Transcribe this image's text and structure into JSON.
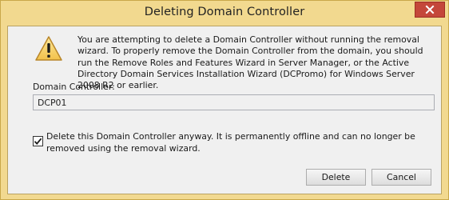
{
  "window": {
    "title": "Deleting Domain Controller"
  },
  "warning": {
    "icon": "warning-icon",
    "message": "You are attempting to delete a Domain Controller without running the removal wizard. To properly remove the Domain Controller from the domain, you should run the Remove Roles and Features Wizard in Server Manager, or the Active Directory Domain Services Installation Wizard (DCPromo) for Windows Server 2008 R2 or earlier."
  },
  "domain_controller": {
    "label": "Domain Controller:",
    "value": "DCP01"
  },
  "confirm": {
    "checked": true,
    "label": "Delete this Domain Controller anyway. It is permanently offline and can no longer be removed using the removal wizard."
  },
  "buttons": {
    "delete_label": "Delete",
    "cancel_label": "Cancel"
  },
  "colors": {
    "frame": "#f2d990",
    "close_button": "#c4473a",
    "client_background": "#f0f0f0"
  }
}
